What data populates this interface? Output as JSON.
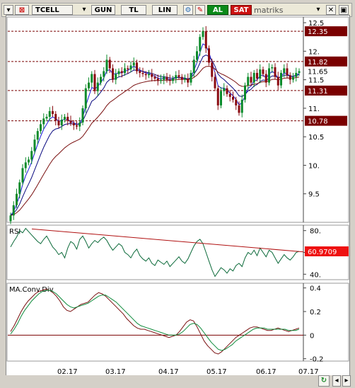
{
  "toolbar": {
    "symbol": "TCELL",
    "period": "GUN",
    "currency": "TL",
    "scale": "LIN",
    "buy_label": "AL",
    "sell_label": "SAT",
    "logo_text": "matriks",
    "buy_color": "#0b8a19",
    "sell_color": "#cc1111"
  },
  "chart_data": [
    {
      "type": "candlestick",
      "title": "",
      "ylim": [
        9.0,
        12.6
      ],
      "yticks": [
        "12.5",
        "12.",
        "11.5",
        "11.",
        "10.5",
        "10.",
        "9.5"
      ],
      "ytick_values": [
        12.5,
        12.0,
        11.5,
        11.0,
        10.5,
        10.0,
        9.5
      ],
      "price_levels": [
        {
          "value": 12.35,
          "label": "12.35"
        },
        {
          "value": 11.82,
          "label": "11.82"
        },
        {
          "value": 11.31,
          "label": "11.31"
        },
        {
          "value": 10.78,
          "label": "10.78"
        }
      ],
      "current_price": {
        "value": 11.65,
        "label": "11.65"
      },
      "x_labels": [
        "02.17",
        "03.17",
        "04.17",
        "05.17",
        "06.17",
        "07.17"
      ],
      "close": [
        9.12,
        9.3,
        9.5,
        9.7,
        9.95,
        10.05,
        10.1,
        10.25,
        10.45,
        10.6,
        10.72,
        10.82,
        10.85,
        10.95,
        10.9,
        10.78,
        10.7,
        10.8,
        10.85,
        10.78,
        10.74,
        10.7,
        10.68,
        10.75,
        11.0,
        11.35,
        11.45,
        11.6,
        11.3,
        11.45,
        11.55,
        11.65,
        11.85,
        11.7,
        11.5,
        11.6,
        11.65,
        11.62,
        11.7,
        11.68,
        11.75,
        11.8,
        11.65,
        11.62,
        11.6,
        11.58,
        11.6,
        11.55,
        11.52,
        11.48,
        11.5,
        11.55,
        11.5,
        11.48,
        11.52,
        11.58,
        11.55,
        11.5,
        11.52,
        11.45,
        11.62,
        11.85,
        12.0,
        12.25,
        12.35,
        12.05,
        11.8,
        11.55,
        11.35,
        11.05,
        11.3,
        11.35,
        11.25,
        11.2,
        11.15,
        11.05,
        10.92,
        11.15,
        11.4,
        11.55,
        11.45,
        11.62,
        11.52,
        11.68,
        11.6,
        11.45,
        11.7,
        11.72,
        11.55,
        11.4,
        11.62,
        11.7,
        11.58,
        11.5,
        11.55,
        11.62,
        11.65
      ],
      "ma_colors": [
        "#1a1adc",
        "#0a0a80",
        "#7a1010"
      ]
    },
    {
      "type": "line",
      "title": "RSI",
      "ylim": [
        35,
        85
      ],
      "yticks": [
        "80.",
        "60.",
        "40."
      ],
      "ytick_values": [
        80,
        60,
        40
      ],
      "last_value": {
        "value": 60.9709,
        "label": "60.9709"
      },
      "trendline": [
        [
          0,
          81.5
        ],
        [
          96,
          60.5
        ]
      ],
      "values": [
        65,
        70,
        74,
        80,
        78,
        82,
        79,
        76,
        73,
        70,
        68,
        72,
        75,
        70,
        65,
        62,
        58,
        60,
        55,
        64,
        70,
        68,
        63,
        72,
        75,
        70,
        64,
        68,
        71,
        69,
        72,
        74,
        71,
        66,
        62,
        65,
        68,
        66,
        60,
        58,
        55,
        60,
        63,
        57,
        54,
        52,
        55,
        50,
        48,
        53,
        51,
        49,
        52,
        47,
        50,
        53,
        56,
        52,
        50,
        54,
        60,
        66,
        70,
        72,
        68,
        60,
        52,
        44,
        38,
        42,
        46,
        44,
        41,
        45,
        43,
        48,
        50,
        47,
        55,
        60,
        58,
        62,
        57,
        64,
        60,
        56,
        62,
        60,
        55,
        50,
        54,
        58,
        55,
        53,
        56,
        60,
        61
      ]
    },
    {
      "type": "line",
      "title": "MA.Conv.Div",
      "ylim": [
        -0.22,
        0.44
      ],
      "yticks": [
        "0.4",
        "0.2",
        "0",
        "-0.2"
      ],
      "ytick_values": [
        0.4,
        0.2,
        0.0,
        -0.2
      ],
      "series": [
        {
          "values": [
            0.03,
            0.08,
            0.14,
            0.2,
            0.25,
            0.29,
            0.32,
            0.35,
            0.37,
            0.38,
            0.39,
            0.38,
            0.36,
            0.33,
            0.29,
            0.24,
            0.21,
            0.2,
            0.22,
            0.24,
            0.26,
            0.27,
            0.28,
            0.31,
            0.34,
            0.36,
            0.35,
            0.33,
            0.3,
            0.27,
            0.24,
            0.21,
            0.18,
            0.14,
            0.11,
            0.08,
            0.06,
            0.05,
            0.05,
            0.04,
            0.03,
            0.02,
            0.01,
            0.0,
            -0.01,
            -0.02,
            -0.01,
            0.0,
            0.03,
            0.07,
            0.11,
            0.13,
            0.12,
            0.07,
            0.01,
            -0.05,
            -0.09,
            -0.12,
            -0.15,
            -0.16,
            -0.14,
            -0.11,
            -0.08,
            -0.05,
            -0.02,
            0.0,
            0.02,
            0.04,
            0.06,
            0.07,
            0.07,
            0.06,
            0.05,
            0.04,
            0.04,
            0.05,
            0.06,
            0.05,
            0.04,
            0.03,
            0.04,
            0.05,
            0.06
          ]
        },
        {
          "values": [
            0.01,
            0.05,
            0.1,
            0.16,
            0.21,
            0.25,
            0.29,
            0.32,
            0.35,
            0.37,
            0.38,
            0.38,
            0.37,
            0.35,
            0.32,
            0.29,
            0.26,
            0.24,
            0.23,
            0.24,
            0.25,
            0.26,
            0.27,
            0.29,
            0.31,
            0.33,
            0.34,
            0.34,
            0.32,
            0.3,
            0.28,
            0.25,
            0.22,
            0.19,
            0.16,
            0.13,
            0.1,
            0.08,
            0.07,
            0.06,
            0.05,
            0.04,
            0.03,
            0.02,
            0.01,
            0.0,
            0.0,
            0.0,
            0.01,
            0.03,
            0.06,
            0.09,
            0.1,
            0.09,
            0.06,
            0.02,
            -0.02,
            -0.06,
            -0.09,
            -0.12,
            -0.13,
            -0.12,
            -0.1,
            -0.08,
            -0.05,
            -0.03,
            -0.01,
            0.01,
            0.03,
            0.05,
            0.06,
            0.06,
            0.06,
            0.05,
            0.05,
            0.05,
            0.05,
            0.05,
            0.05,
            0.04,
            0.04,
            0.04,
            0.05
          ]
        }
      ],
      "series_colors": [
        "#7a1010",
        "#0c8a3a"
      ]
    }
  ]
}
